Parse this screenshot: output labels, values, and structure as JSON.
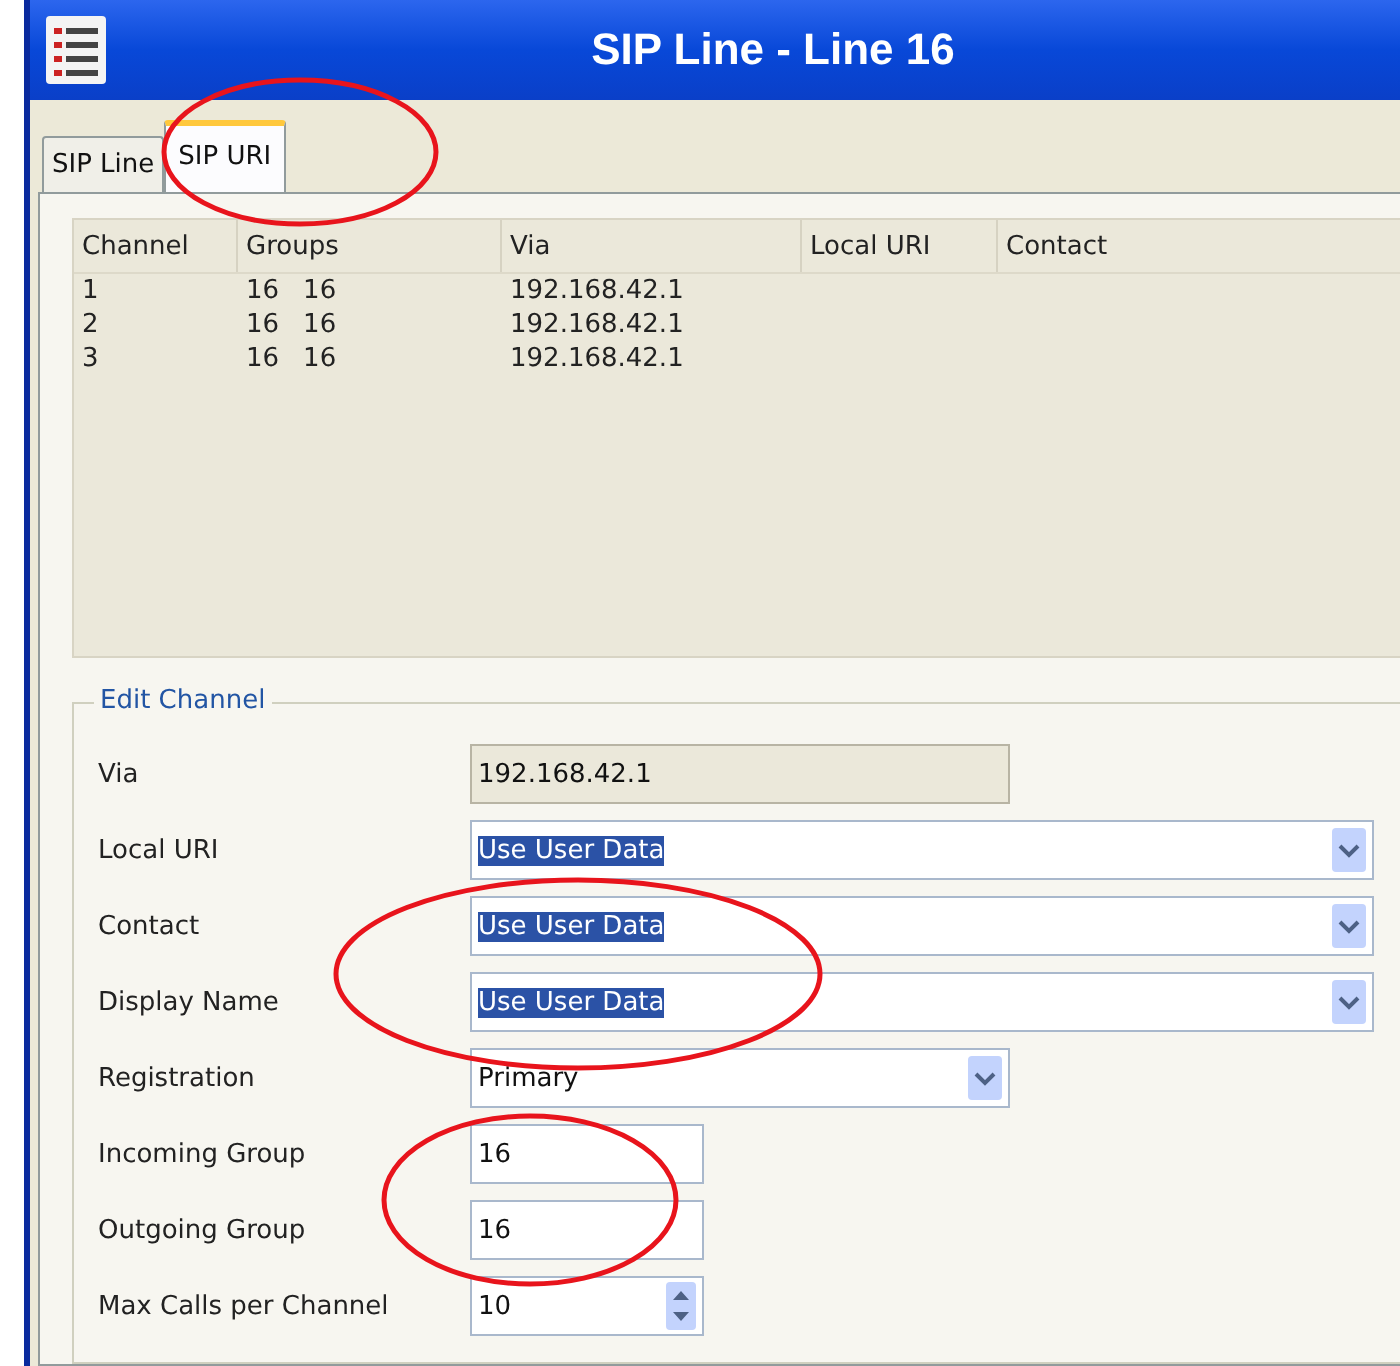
{
  "window": {
    "title": "SIP Line - Line 16"
  },
  "tabs": [
    {
      "label": "SIP Line",
      "selected": false
    },
    {
      "label": "SIP URI",
      "selected": true
    }
  ],
  "channels": {
    "columns": [
      "Channel",
      "Groups",
      "Via",
      "Local URI",
      "Contact"
    ],
    "rows": [
      {
        "channel": "1",
        "groups": [
          "16",
          "16"
        ],
        "via": "192.168.42.1"
      },
      {
        "channel": "2",
        "groups": [
          "16",
          "16"
        ],
        "via": "192.168.42.1"
      },
      {
        "channel": "3",
        "groups": [
          "16",
          "16"
        ],
        "via": "192.168.42.1"
      }
    ]
  },
  "edit_channel": {
    "title": "Edit Channel",
    "fields": [
      {
        "label": "Via",
        "kind": "text",
        "value": "192.168.42.1",
        "disabled": true,
        "highlighted": false
      },
      {
        "label": "Local URI",
        "kind": "combo",
        "value": "Use User Data",
        "disabled": false,
        "highlighted": true
      },
      {
        "label": "Contact",
        "kind": "combo",
        "value": "Use User Data",
        "disabled": false,
        "highlighted": true
      },
      {
        "label": "Display Name",
        "kind": "combo",
        "value": "Use User Data",
        "disabled": false,
        "highlighted": true
      },
      {
        "label": "Registration",
        "kind": "combo",
        "value": "Primary",
        "disabled": false,
        "highlighted": false
      },
      {
        "label": "Incoming Group",
        "kind": "text",
        "value": "16",
        "disabled": false,
        "highlighted": false
      },
      {
        "label": "Outgoing Group",
        "kind": "text",
        "value": "16",
        "disabled": false,
        "highlighted": false
      },
      {
        "label": "Max Calls per Channel",
        "kind": "spinner",
        "value": "10",
        "disabled": false,
        "highlighted": false
      }
    ]
  },
  "annotations": [
    {
      "kind": "ellipse"
    },
    {
      "kind": "ellipse"
    },
    {
      "kind": "ellipse"
    }
  ]
}
